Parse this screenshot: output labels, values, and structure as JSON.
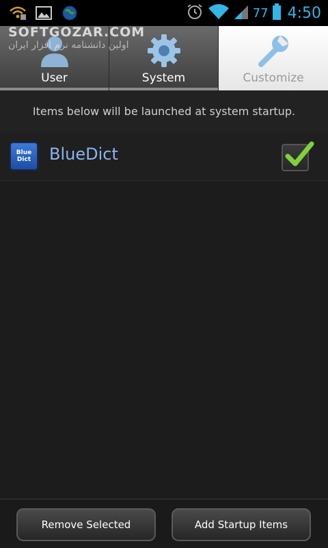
{
  "status_bar": {
    "icons_left": [
      "wifi-warning-icon",
      "picture-icon",
      "globe-icon"
    ],
    "icons_right": [
      "alarm-icon",
      "wifi-icon",
      "signal-icon",
      "battery-icon"
    ],
    "battery_level": "77",
    "time": "4:50",
    "accent": "#33b5e5"
  },
  "watermark": {
    "line1": "SOFTGOZAR.COM",
    "line2": "اولین دانشنامه نرم افزار ایران"
  },
  "tabs": [
    {
      "label": "User",
      "icon": "user-icon",
      "active": false
    },
    {
      "label": "System",
      "icon": "gear-icon",
      "active": false
    },
    {
      "label": "Customize",
      "icon": "wrench-icon",
      "active": true
    }
  ],
  "description": "Items below will be launched at system startup.",
  "items": [
    {
      "name": "BlueDict",
      "icon_text_1": "Blue",
      "icon_text_2": "Dict",
      "checked": true
    }
  ],
  "buttons": {
    "remove": "Remove Selected",
    "add": "Add Startup Items"
  }
}
